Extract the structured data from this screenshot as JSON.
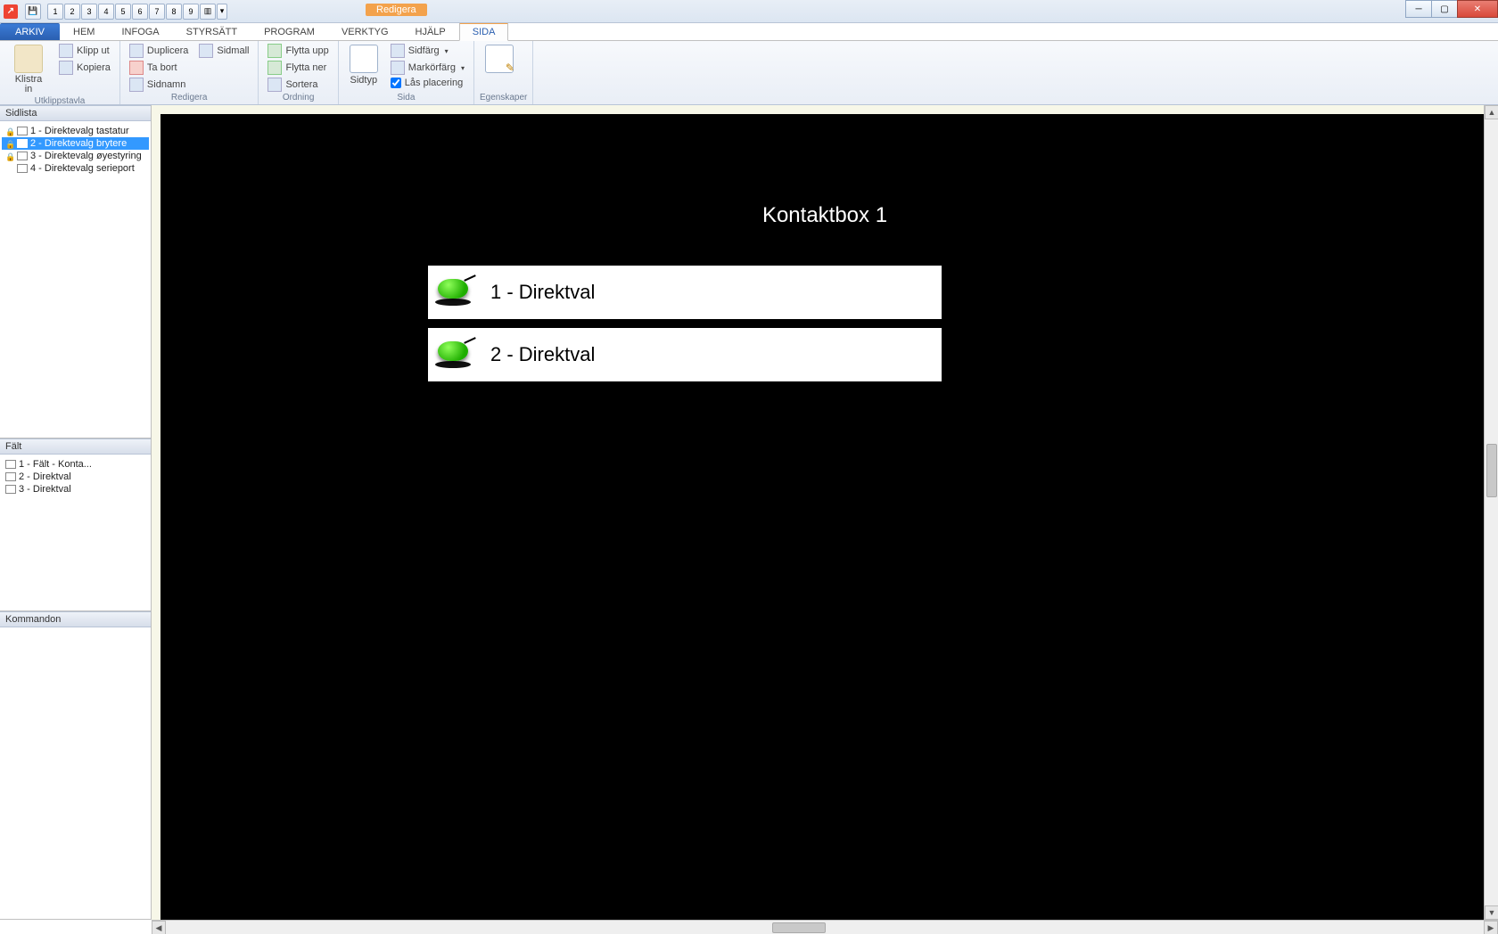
{
  "titlebar": {
    "context_tag": "Redigera",
    "doc_title": ""
  },
  "qat": {
    "numbers": [
      "1",
      "2",
      "3",
      "4",
      "5",
      "6",
      "7",
      "8",
      "9"
    ]
  },
  "tabs": {
    "file": "ARKIV",
    "items": [
      "HEM",
      "INFOGA",
      "STYRSÄTT",
      "PROGRAM",
      "VERKTYG",
      "HJÄLP"
    ],
    "contextual": "SIDA"
  },
  "ribbon": {
    "clipboard": {
      "big": "Klistra in",
      "cut": "Klipp ut",
      "copy": "Kopiera",
      "label": "Utklippstavla"
    },
    "edit": {
      "duplicate": "Duplicera",
      "template": "Sidmall",
      "delete": "Ta bort",
      "rename": "Sidnamn",
      "label": "Redigera"
    },
    "order": {
      "moveup": "Flytta upp",
      "movedown": "Flytta ner",
      "sort": "Sortera",
      "label": "Ordning"
    },
    "page": {
      "type": "Sidtyp",
      "pagecolor": "Sidfärg",
      "markcolor": "Markörfärg",
      "lock": "Lås placering",
      "label": "Sida"
    },
    "props": {
      "btn": "",
      "label": "Egenskaper"
    }
  },
  "panels": {
    "sidlista": {
      "title": "Sidlista",
      "items": [
        {
          "locked": true,
          "text": "1 - Direktevalg tastatur"
        },
        {
          "locked": true,
          "text": "2 - Direktevalg brytere",
          "selected": true
        },
        {
          "locked": true,
          "text": "3 - Direktevalg øyestyring"
        },
        {
          "locked": false,
          "text": "4 - Direktevalg serieport"
        }
      ]
    },
    "falt": {
      "title": "Fält",
      "items": [
        {
          "text": "1 - Fält - Konta..."
        },
        {
          "text": "2 - Direktval"
        },
        {
          "text": "3 - Direktval"
        }
      ]
    },
    "kommandon": {
      "title": "Kommandon"
    }
  },
  "artboard": {
    "title": "Kontaktbox 1",
    "row1": "1 - Direktval",
    "row2": "2 - Direktval"
  }
}
